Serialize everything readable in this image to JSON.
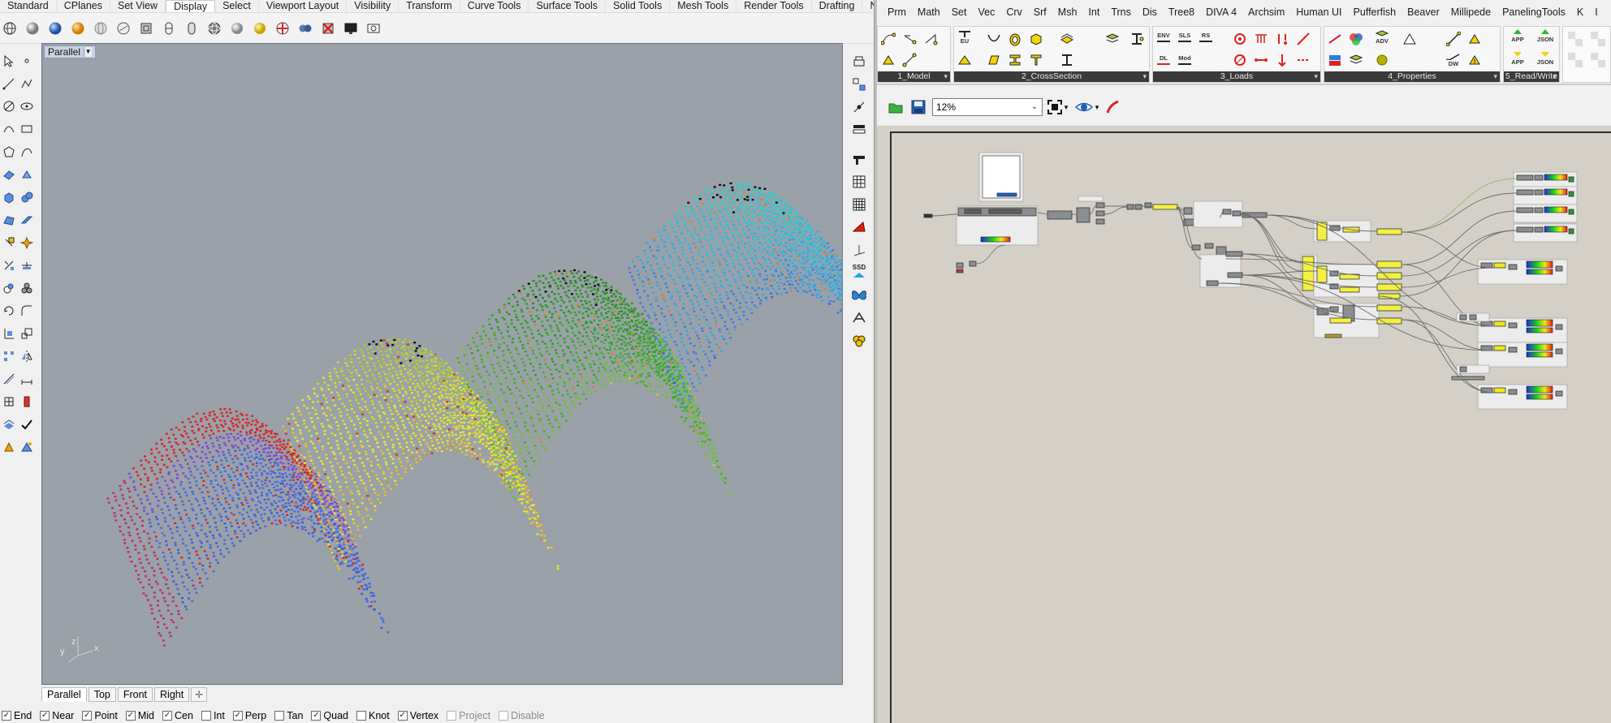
{
  "rhino": {
    "tabs": [
      "Standard",
      "CPlanes",
      "Set View",
      "Display",
      "Select",
      "Viewport Layout",
      "Visibility",
      "Transform",
      "Curve Tools",
      "Surface Tools",
      "Solid Tools",
      "Mesh Tools",
      "Render Tools",
      "Drafting",
      "New in"
    ],
    "active_tab": "Display",
    "viewport": {
      "title": "Parallel",
      "axes": {
        "y": "y",
        "z": "z",
        "x": "x"
      }
    },
    "viewport_tabs": [
      "Parallel",
      "Top",
      "Front",
      "Right"
    ],
    "active_viewport_tab": "Parallel",
    "osnaps": [
      {
        "label": "End",
        "checked": true,
        "enabled": true
      },
      {
        "label": "Near",
        "checked": true,
        "enabled": true
      },
      {
        "label": "Point",
        "checked": true,
        "enabled": true
      },
      {
        "label": "Mid",
        "checked": true,
        "enabled": true
      },
      {
        "label": "Cen",
        "checked": true,
        "enabled": true
      },
      {
        "label": "Int",
        "checked": false,
        "enabled": true
      },
      {
        "label": "Perp",
        "checked": true,
        "enabled": true
      },
      {
        "label": "Tan",
        "checked": false,
        "enabled": true
      },
      {
        "label": "Quad",
        "checked": true,
        "enabled": true
      },
      {
        "label": "Knot",
        "checked": false,
        "enabled": true
      },
      {
        "label": "Vertex",
        "checked": true,
        "enabled": true
      },
      {
        "label": "Project",
        "checked": false,
        "enabled": false
      },
      {
        "label": "Disable",
        "checked": false,
        "enabled": false
      }
    ],
    "right_toolbar_text": {
      "ssd": "SSD"
    }
  },
  "grasshopper": {
    "menu": [
      "Prm",
      "Math",
      "Set",
      "Vec",
      "Crv",
      "Srf",
      "Msh",
      "Int",
      "Trns",
      "Dis",
      "Tree8",
      "DIVA 4",
      "Archsim",
      "Human UI",
      "Pufferfish",
      "Beaver",
      "Millipede",
      "PanelingTools",
      "K",
      "I"
    ],
    "ribbon_groups": [
      "1_Model",
      "2_CrossSection",
      "3_Loads",
      "4_Properties",
      "5_Read/Write"
    ],
    "ribbon_icon_text": {
      "env": "ENV",
      "sls": "SLS",
      "rs": "RS",
      "dl": "DL",
      "mod": "Mod",
      "eu": "EU",
      "app1": "APP",
      "app2": "APP",
      "json1": "JSON",
      "json2": "JSON",
      "adv": "ADV",
      "dw": "DW"
    },
    "zoom": "12%"
  },
  "colors": {
    "viewport_bg": "#9aa1a9",
    "gh_canvas_bg": "#d4d0c8",
    "ribbon_label_bg": "#3a3a3a",
    "component_yellow": "#f3f041",
    "component_gray": "#8b8d90"
  }
}
